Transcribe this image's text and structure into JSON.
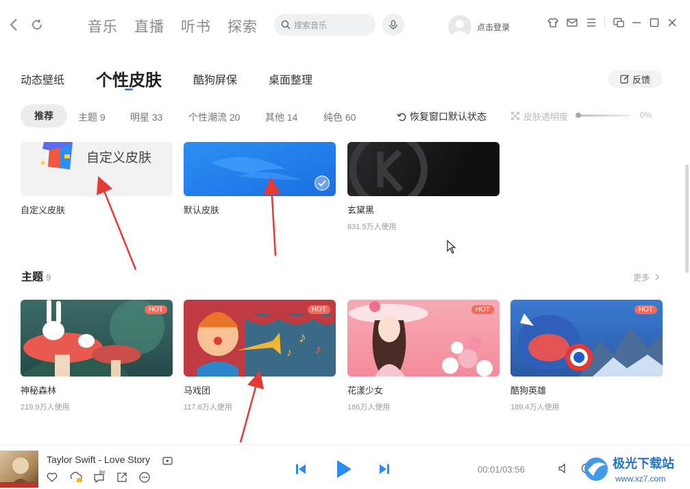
{
  "nav": {
    "tabs": [
      "音乐",
      "直播",
      "听书",
      "探索"
    ],
    "search_placeholder": "搜索音乐",
    "login_label": "点击登录"
  },
  "skin_tabs": [
    "动态壁纸",
    "个性皮肤",
    "酷狗屏保",
    "桌面整理"
  ],
  "feedback_label": "反馈",
  "filters": {
    "active": "推荐",
    "items": [
      "主题 9",
      "明星 33",
      "个性潮流 20",
      "其他 14",
      "纯色 60"
    ]
  },
  "restore_label": "恢复窗口默认状态",
  "opacity": {
    "label": "皮肤透明度",
    "value": "0%",
    "level": 0
  },
  "top_skins": [
    {
      "name": "自定义皮肤",
      "thumb_text": "自定义皮肤"
    },
    {
      "name": "默认皮肤",
      "selected": true
    },
    {
      "name": "玄黛黑",
      "usage": "831.5万人使用"
    }
  ],
  "theme_section": {
    "title": "主题",
    "count": "9",
    "more": "更多",
    "items": [
      {
        "name": "神秘森林",
        "usage": "219.9万人使用",
        "badge": "HOT"
      },
      {
        "name": "马戏团",
        "usage": "117.6万人使用",
        "badge": "HOT"
      },
      {
        "name": "花漾少女",
        "usage": "186万人使用",
        "badge": "HOT"
      },
      {
        "name": "酷狗英雄",
        "usage": "189.4万人使用",
        "badge": "HOT"
      }
    ]
  },
  "player": {
    "song": "Taylor Swift - Love Story",
    "elapsed": "00:01",
    "duration": "03:56",
    "time_text": "00:01/03:56",
    "vip_label": "Bit"
  },
  "watermark": {
    "brand": "极光下载站",
    "url": "www.xz7.com"
  },
  "colors": {
    "accent": "#2a8cf5",
    "hot": "#f26b5b",
    "arrow": "#e53935"
  }
}
